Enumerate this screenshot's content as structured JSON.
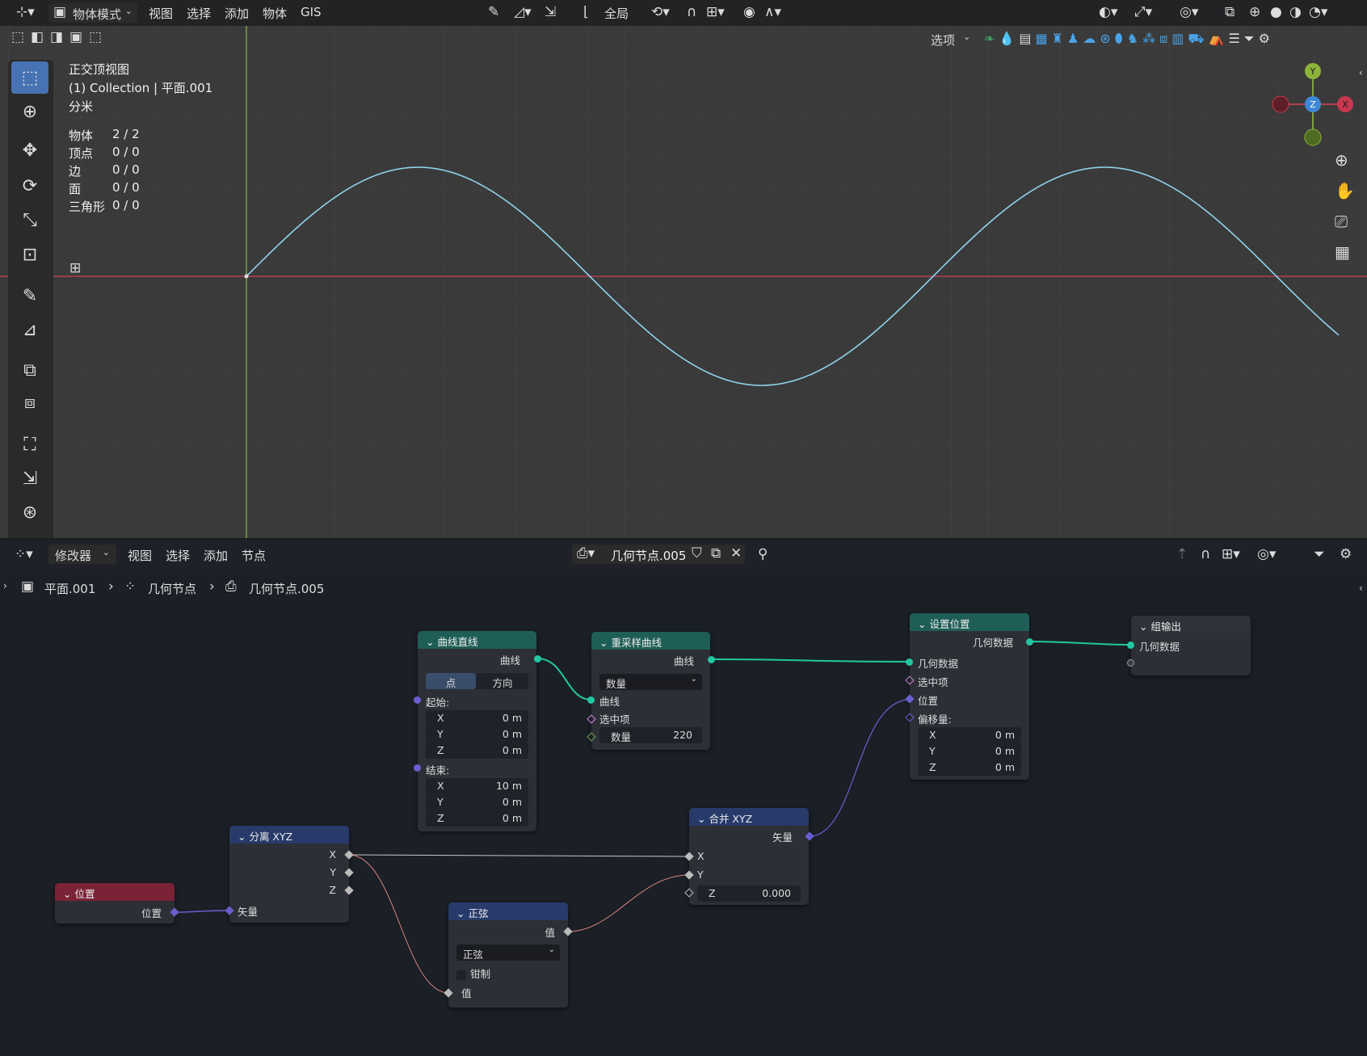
{
  "viewport": {
    "header": {
      "mode": "物体模式",
      "menus": [
        "视图",
        "选择",
        "添加",
        "物体",
        "GIS"
      ],
      "transform": "全局",
      "options": "选项"
    },
    "overlay": {
      "view_name": "正交顶视图",
      "collection": "(1) Collection | 平面.001",
      "units": "分米",
      "stats": [
        {
          "label": "物体",
          "value": "2 / 2"
        },
        {
          "label": "顶点",
          "value": "0 / 0"
        },
        {
          "label": "边",
          "value": "0 / 0"
        },
        {
          "label": "面",
          "value": "0 / 0"
        },
        {
          "label": "三角形",
          "value": "0 / 0"
        }
      ]
    },
    "gizmo": {
      "y": "Y",
      "z": "Z",
      "x": "X"
    },
    "colors": {
      "curve": "#8fd3ec",
      "x_axis": "#b34050",
      "y_axis": "#7fa040",
      "grid": "#424242"
    }
  },
  "node_editor": {
    "header": {
      "editor": "修改器",
      "menus": [
        "视图",
        "选择",
        "添加",
        "节点"
      ],
      "tree_name": "几何节点.005"
    },
    "breadcrumb": {
      "object": "平面.001",
      "modifier": "几何节点",
      "tree": "几何节点.005"
    },
    "nodes": {
      "curve_line": {
        "title": "曲线直线",
        "out": "曲线",
        "mode_a": "点",
        "mode_b": "方向",
        "start": "起始:",
        "end": "结束:",
        "start_vals": [
          {
            "axis": "X",
            "val": "0 m"
          },
          {
            "axis": "Y",
            "val": "0 m"
          },
          {
            "axis": "Z",
            "val": "0 m"
          }
        ],
        "end_vals": [
          {
            "axis": "X",
            "val": "10 m"
          },
          {
            "axis": "Y",
            "val": "0 m"
          },
          {
            "axis": "Z",
            "val": "0 m"
          }
        ]
      },
      "resample": {
        "title": "重采样曲线",
        "out": "曲线",
        "mode": "数量",
        "in_curve": "曲线",
        "in_sel": "选中项",
        "count_label": "数量",
        "count": "220"
      },
      "set_pos": {
        "title": "设置位置",
        "out": "几何数据",
        "in_geo": "几何数据",
        "in_sel": "选中项",
        "in_pos": "位置",
        "offset": "偏移量:",
        "offset_vals": [
          {
            "axis": "X",
            "val": "0 m"
          },
          {
            "axis": "Y",
            "val": "0 m"
          },
          {
            "axis": "Z",
            "val": "0 m"
          }
        ]
      },
      "group_out": {
        "title": "组输出",
        "in_geo": "几何数据"
      },
      "combine": {
        "title": "合并 XYZ",
        "out": "矢量",
        "x": "X",
        "y": "Y",
        "z_label": "Z",
        "z_val": "0.000"
      },
      "separate": {
        "title": "分离 XYZ",
        "x": "X",
        "y": "Y",
        "z": "Z",
        "in": "矢量"
      },
      "position": {
        "title": "位置",
        "out": "位置"
      },
      "sine": {
        "title": "正弦",
        "out": "值",
        "op": "正弦",
        "clamp": "钳制",
        "in": "值"
      }
    }
  }
}
